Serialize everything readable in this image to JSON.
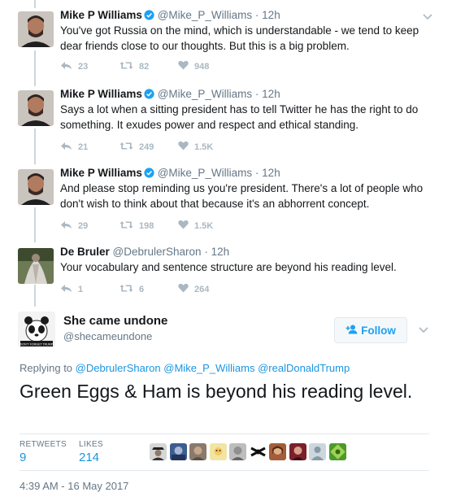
{
  "tweets": [
    {
      "name": "Mike P Williams",
      "handle": "@Mike_P_Williams",
      "time": "12h",
      "text": "You've got Russia on the mind, which is understandable - we tend to keep dear friends close to our thoughts. But this is a big problem.",
      "replies": "23",
      "retweets": "82",
      "likes": "948"
    },
    {
      "name": "Mike P Williams",
      "handle": "@Mike_P_Williams",
      "time": "12h",
      "text": "Says a lot when a sitting president has to tell Twitter he has the right to do something. It exudes power and respect and ethical standing.",
      "replies": "21",
      "retweets": "249",
      "likes": "1.5K"
    },
    {
      "name": "Mike P Williams",
      "handle": "@Mike_P_Williams",
      "time": "12h",
      "text": "And please stop reminding us you're president. There's a lot of people who don't wish to think about that because it's an abhorrent concept.",
      "replies": "29",
      "retweets": "198",
      "likes": "1.5K"
    },
    {
      "name": "De Bruler",
      "handle": "@DebrulerSharon",
      "time": "12h",
      "text": "Your vocabulary and sentence structure are beyond his reading level.",
      "replies": "1",
      "retweets": "6",
      "likes": "264"
    }
  ],
  "main": {
    "name": "She came undone",
    "handle": "@shecameundone",
    "follow_label": "Follow",
    "replying_prefix": "Replying to",
    "mentions": [
      "@DebrulerSharon",
      "@Mike_P_Williams",
      "@realDonaldTrump"
    ],
    "text": "Green Eggs & Ham is beyond his reading level.",
    "retweets_label": "RETWEETS",
    "retweets": "9",
    "likes_label": "LIKES",
    "likes": "214",
    "timestamp": "4:39 AM - 16 May 2017",
    "avatar_caption": "DON'T FORGET TRUMP"
  },
  "icons": {
    "verified": "verified-badge-icon",
    "reply": "reply-icon",
    "retweet": "retweet-icon",
    "like": "heart-icon",
    "caret": "chevron-down-icon",
    "follow": "add-user-icon"
  },
  "colors": {
    "accent": "#1da1f2",
    "link": "#1b95e0",
    "muted": "#657786",
    "action": "#aab8c2"
  }
}
